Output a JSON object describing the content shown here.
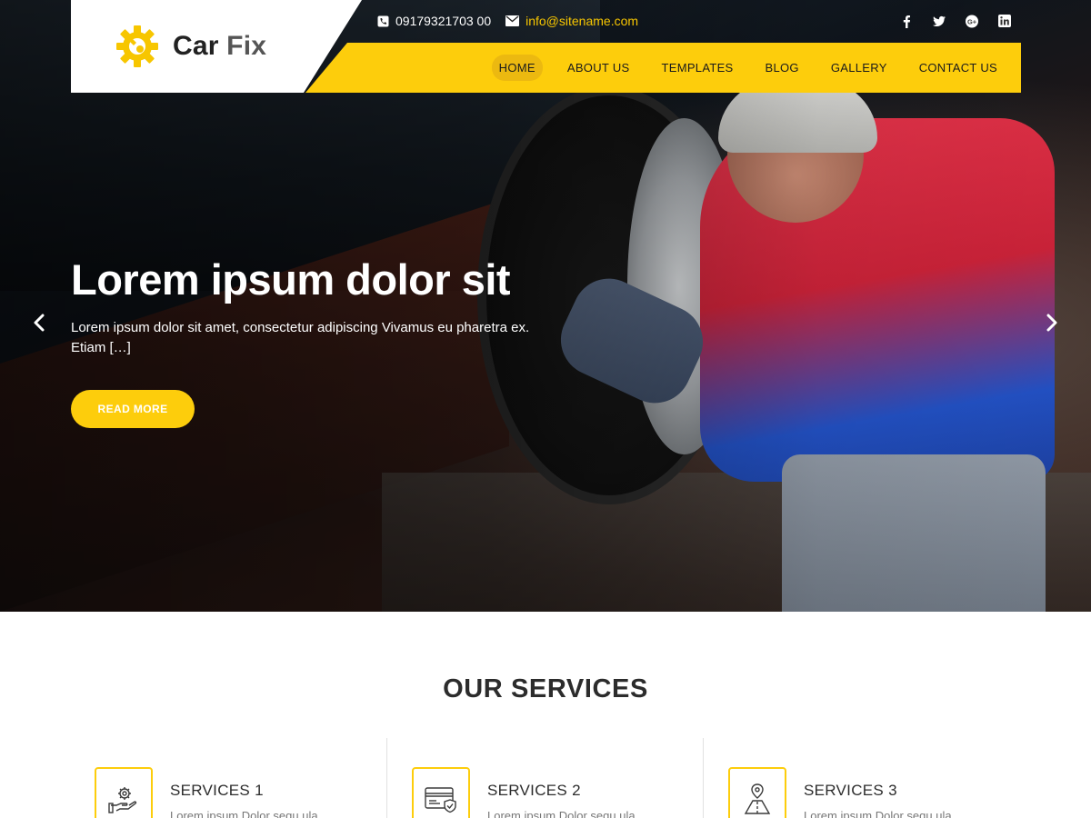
{
  "brand": {
    "name_part1": "Car",
    "name_part2": "Fix",
    "accent": "#fdcd0c"
  },
  "topbar": {
    "phone": "09179321703 00",
    "email": "info@sitename.com",
    "social_icons": [
      "facebook-icon",
      "twitter-icon",
      "google-plus-icon",
      "linkedin-icon"
    ]
  },
  "nav": {
    "items": [
      "HOME",
      "ABOUT US",
      "TEMPLATES",
      "BLOG",
      "GALLERY",
      "CONTACT US"
    ],
    "active": "HOME"
  },
  "hero": {
    "title": "Lorem ipsum dolor sit",
    "description": "Lorem ipsum dolor sit amet, consectetur adipiscing Vivamus eu pharetra ex. Etiam […]",
    "button": "READ MORE"
  },
  "services": {
    "title": "OUR SERVICES",
    "items": [
      {
        "name": "SERVICES 1",
        "icon": "gear-hand-icon",
        "text": "Lorem ipsum Dolor sequ ula"
      },
      {
        "name": "SERVICES 2",
        "icon": "card-shield-icon",
        "text": "Lorem ipsum Dolor sequ ula"
      },
      {
        "name": "SERVICES 3",
        "icon": "road-pin-icon",
        "text": "Lorem ipsum Dolor sequ ula"
      }
    ]
  }
}
